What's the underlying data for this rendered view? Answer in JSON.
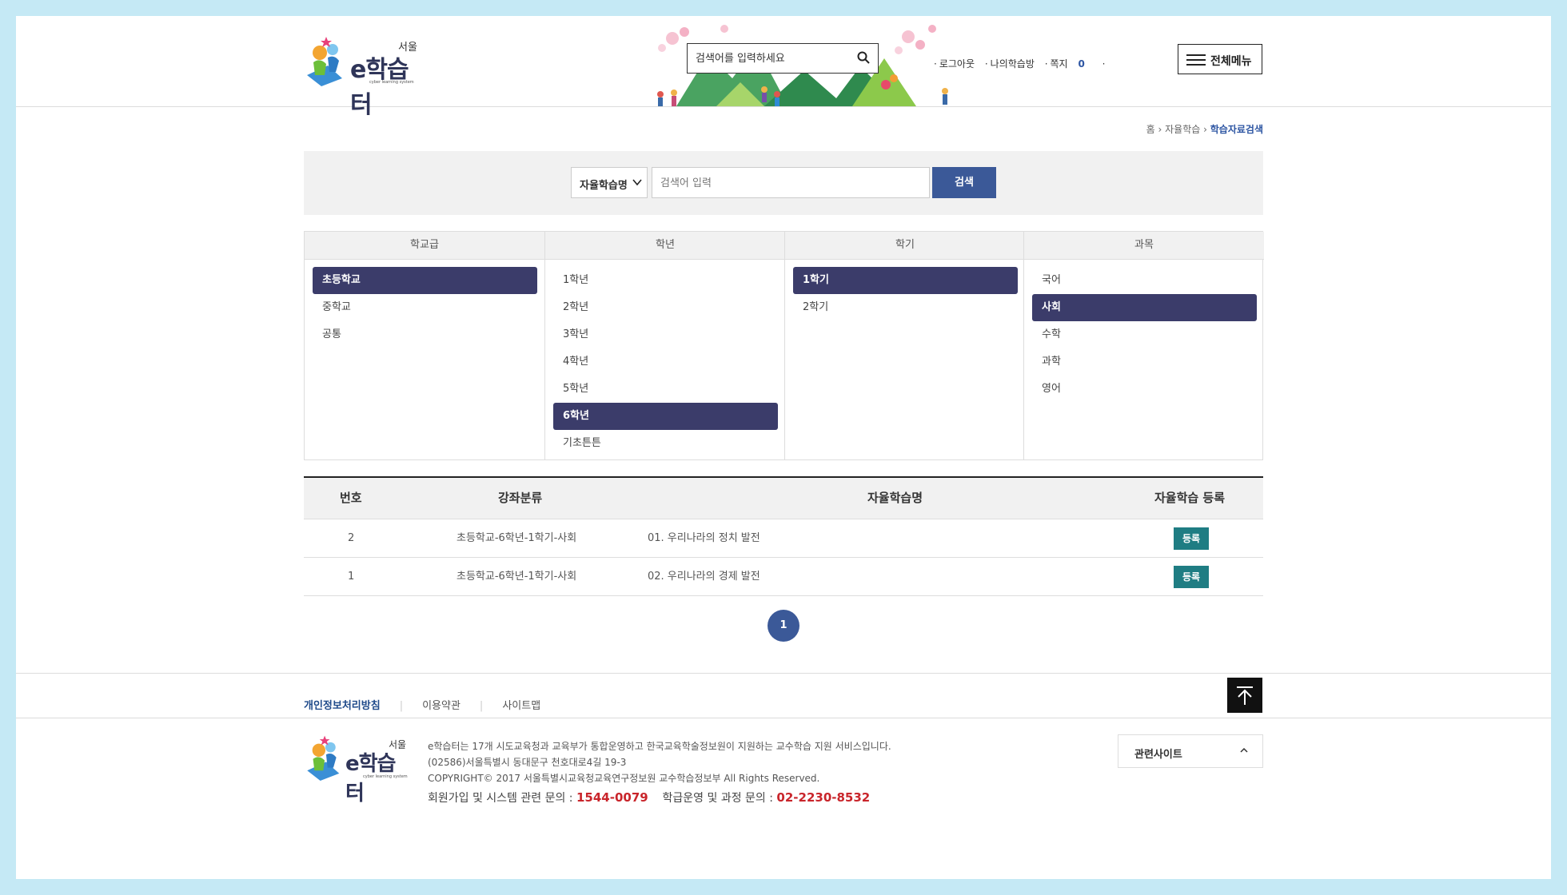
{
  "header": {
    "logo": {
      "region": "서울",
      "brand": "e학습터",
      "tagline": "cyber learning system"
    },
    "search_placeholder": "검색어를 입력하세요",
    "util_links": [
      "로그아웃",
      "나의학습방",
      "쪽지"
    ],
    "message_count": "0",
    "all_menu_label": "전체메뉴"
  },
  "breadcrumb": [
    "홈",
    "자율학습",
    "학습자료검색"
  ],
  "search": {
    "select_value": "자율학습명",
    "keyword_placeholder": "검색어 입력",
    "button_label": "검색"
  },
  "filters": [
    {
      "header": "학교급",
      "items": [
        "초등학교",
        "중학교",
        "공통"
      ],
      "selected": 0
    },
    {
      "header": "학년",
      "items": [
        "1학년",
        "2학년",
        "3학년",
        "4학년",
        "5학년",
        "6학년",
        "기초튼튼"
      ],
      "selected": 5
    },
    {
      "header": "학기",
      "items": [
        "1학기",
        "2학기"
      ],
      "selected": 0
    },
    {
      "header": "과목",
      "items": [
        "국어",
        "사회",
        "수학",
        "과학",
        "영어"
      ],
      "selected": 1
    }
  ],
  "table": {
    "headers": [
      "번호",
      "강좌분류",
      "자율학습명",
      "자율학습 등록"
    ],
    "rows": [
      {
        "num": "2",
        "category": "초등학교-6학년-1학기-사회",
        "title": "01. 우리나라의 정치 발전",
        "action": "등록"
      },
      {
        "num": "1",
        "category": "초등학교-6학년-1학기-사회",
        "title": "02. 우리나라의 경제 발전",
        "action": "등록"
      }
    ]
  },
  "pagination": {
    "current": "1"
  },
  "footer": {
    "links": [
      "개인정보처리방침",
      "이용약관",
      "사이트맵"
    ],
    "info": [
      "e학습터는 17개 시도교육청과 교육부가 통합운영하고 한국교육학술정보원이 지원하는 교수학습 지원 서비스입니다.",
      "(02586)서울특별시 동대문구 천호대로4길 19-3",
      "COPYRIGHT© 2017 서울특별시교육청교육연구정보원 교수학습정보부 All Rights Reserved."
    ],
    "contact_label_1": "회원가입 및 시스템 관련 문의 :",
    "contact_tel_1": "1544-0079",
    "contact_label_2": "학급운영 및 과정 문의 :",
    "contact_tel_2": "02-2230-8532",
    "related_sites_label": "관련사이트"
  },
  "colors": {
    "accent": "#3b5998",
    "selected_filter": "#3b3c6a",
    "register_button": "#1f7d83",
    "phone": "#c9252b",
    "page_background": "#c5e9f5"
  }
}
